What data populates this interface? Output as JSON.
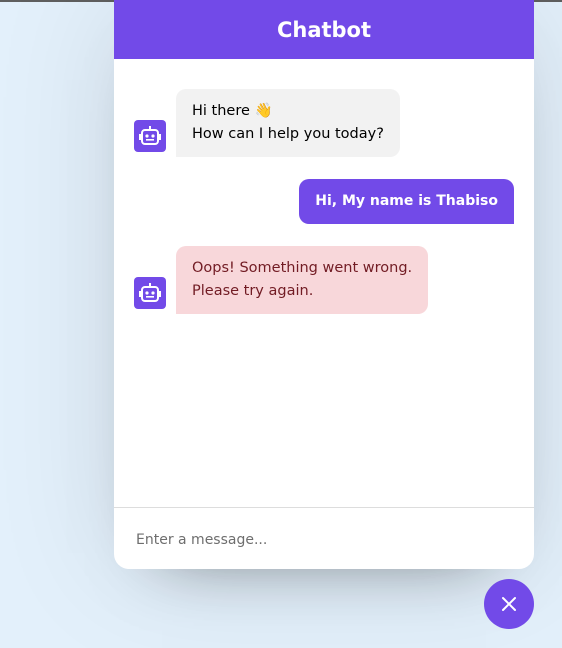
{
  "header": {
    "title": "Chatbot"
  },
  "messages": [
    {
      "sender": "bot",
      "lines": [
        "Hi there 👋",
        "How can I help you today?"
      ]
    },
    {
      "sender": "user",
      "lines": [
        "Hi, My name is Thabiso"
      ]
    },
    {
      "sender": "bot",
      "status": "error",
      "lines": [
        "Oops! Something went wrong.",
        "Please try again."
      ]
    }
  ],
  "input": {
    "placeholder": "Enter a message...",
    "value": ""
  },
  "toggler": {
    "icon": "close-icon"
  },
  "colors": {
    "accent": "#724ae8",
    "bot_bubble": "#f2f2f2",
    "error_bubble": "#f8d7da",
    "error_text": "#721c24",
    "background": "#e3f0fb"
  }
}
